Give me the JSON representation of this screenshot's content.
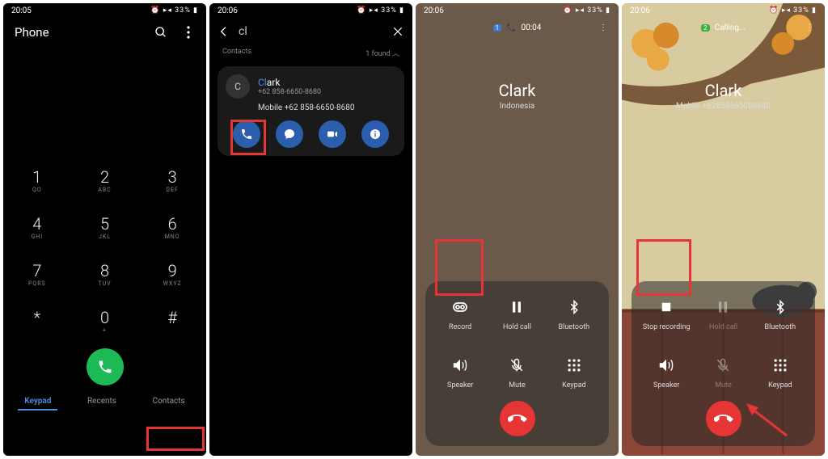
{
  "status": {
    "time1": "20:05",
    "time2": "20:06",
    "battery": "33%"
  },
  "s1": {
    "title": "Phone",
    "keys": [
      {
        "n": "1",
        "l": "QO"
      },
      {
        "n": "2",
        "l": "ABC"
      },
      {
        "n": "3",
        "l": "DEF"
      },
      {
        "n": "4",
        "l": "GHI"
      },
      {
        "n": "5",
        "l": "JKL"
      },
      {
        "n": "6",
        "l": "MNO"
      },
      {
        "n": "7",
        "l": "PQRS"
      },
      {
        "n": "8",
        "l": "TUV"
      },
      {
        "n": "9",
        "l": "WXYZ"
      },
      {
        "n": "*",
        "l": ""
      },
      {
        "n": "0",
        "l": "+"
      },
      {
        "n": "#",
        "l": ""
      }
    ],
    "tabs": {
      "keypad": "Keypad",
      "recents": "Recents",
      "contacts": "Contacts"
    }
  },
  "s2": {
    "query": "cl",
    "section": "Contacts",
    "found": "1 found",
    "contact": {
      "initial": "C",
      "name_match": "Cl",
      "name_rest": "ark",
      "sub": "+62 858-6650-8680",
      "mobile": "Mobile +62 858-6650-8680"
    }
  },
  "s3": {
    "duration": "00:04",
    "name": "Clark",
    "sub": "Indonesia",
    "opts": {
      "record": "Record",
      "hold": "Hold call",
      "bt": "Bluetooth",
      "speaker": "Speaker",
      "mute": "Mute",
      "keypad": "Keypad"
    }
  },
  "s4": {
    "status": "Calling...",
    "name": "Clark",
    "sub": "Mobile +62858665088680",
    "opts": {
      "stop": "Stop recording",
      "hold": "Hold call",
      "bt": "Bluetooth",
      "speaker": "Speaker",
      "mute": "Mute",
      "keypad": "Keypad"
    }
  }
}
